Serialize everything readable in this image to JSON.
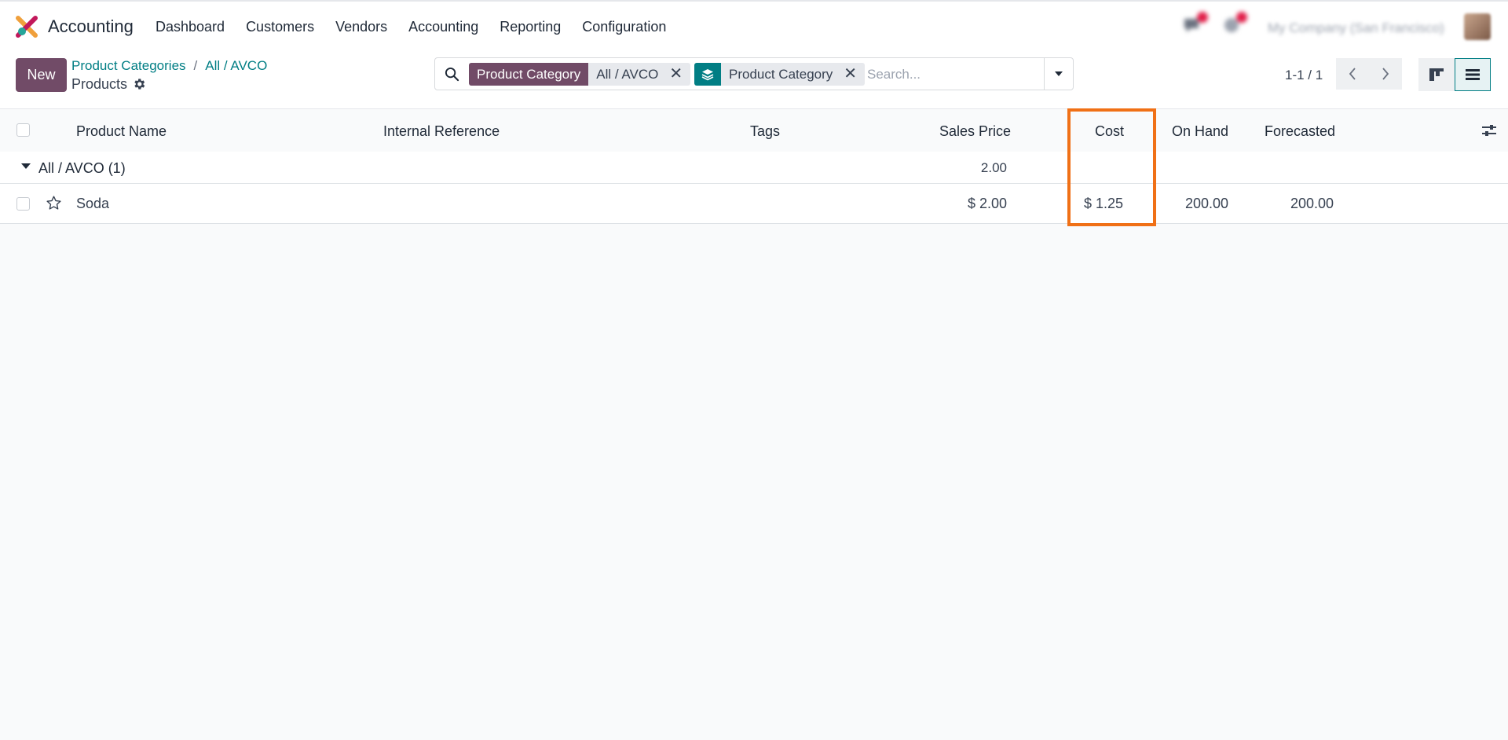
{
  "app": {
    "name": "Accounting",
    "menu": [
      "Dashboard",
      "Customers",
      "Vendors",
      "Accounting",
      "Reporting",
      "Configuration"
    ],
    "company": "My Company (San Francisco)",
    "colors": {
      "primary": "#714b67",
      "teal": "#017e84",
      "highlight": "#f07016"
    }
  },
  "control": {
    "new_label": "New",
    "breadcrumb": [
      "Product Categories",
      "All / AVCO"
    ],
    "title": "Products",
    "facets": [
      {
        "label": "Product Category",
        "value": "All / AVCO"
      },
      {
        "icon": "layers-icon",
        "value": "Product Category"
      }
    ],
    "search_placeholder": "Search...",
    "pager": "1-1 / 1"
  },
  "list": {
    "columns": {
      "name": "Product Name",
      "ref": "Internal Reference",
      "tags": "Tags",
      "price": "Sales Price",
      "cost": "Cost",
      "onhand": "On Hand",
      "forecast": "Forecasted"
    },
    "group": {
      "label": "All / AVCO (1)",
      "price_sum": "2.00"
    },
    "rows": [
      {
        "name": "Soda",
        "ref": "",
        "tags": "",
        "price": "$ 2.00",
        "cost": "$ 1.25",
        "onhand": "200.00",
        "forecast": "200.00"
      }
    ]
  }
}
